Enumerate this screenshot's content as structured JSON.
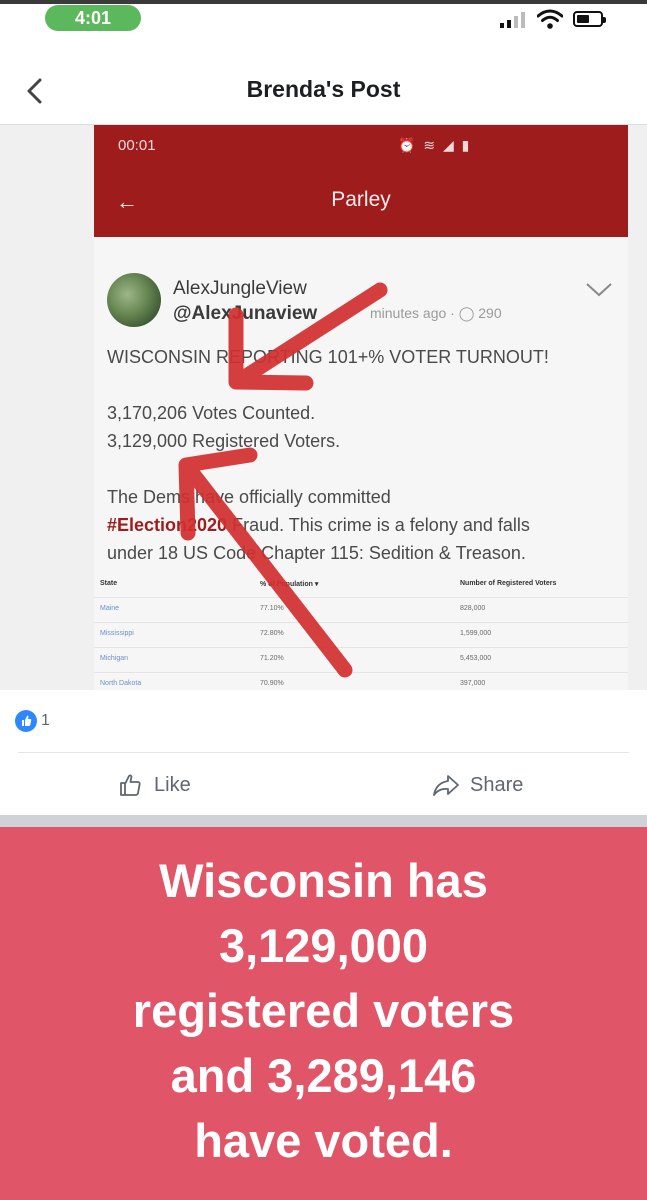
{
  "status_bar": {
    "time": "4:01"
  },
  "header": {
    "title": "Brenda's Post"
  },
  "embedded": {
    "status_time": "00:01",
    "status_icons": "⏰ ≋ ◢ ▮",
    "app_back": "←",
    "app_title": "Parley",
    "poster_name": "AlexJungleView",
    "poster_handle": "@AlexJunaview",
    "post_meta": "minutes ago · ◯ 290",
    "headline": "WISCONSIN REPORTING 101+% VOTER TURNOUT!",
    "votes_counted": "3,170,206 Votes Counted.",
    "registered_voters": "3,129,000 Registered Voters.",
    "body_line1": "The Dems have officially committed",
    "body_hashtag": "#Election2020",
    "body_line2_rest": " Fraud. This crime is a felony and falls",
    "body_line3": "under 18 US Code Chapter 115: Sedition & Treason.",
    "table": {
      "headers": [
        "State",
        "% of Population ▾",
        "Number of Registered Voters"
      ],
      "rows": [
        [
          "Maine",
          "77.10%",
          "828,000"
        ],
        [
          "Mississippi",
          "72.80%",
          "1,599,000"
        ],
        [
          "Michigan",
          "71.20%",
          "5,453,000"
        ],
        [
          "North Dakota",
          "70.90%",
          "397,000"
        ]
      ]
    }
  },
  "reactions": {
    "like_count": "1"
  },
  "actions": {
    "like_label": "Like",
    "share_label": "Share"
  },
  "banner": {
    "lines": [
      "Wisconsin has",
      "3,129,000",
      "registered voters",
      "and 3,289,146",
      "have voted."
    ],
    "background": "#e05668"
  },
  "colors": {
    "app_red": "#9e1c1c",
    "facebook_blue": "#2d88ff",
    "status_green": "#5cb85c",
    "arrow_red": "#d32f2f"
  }
}
